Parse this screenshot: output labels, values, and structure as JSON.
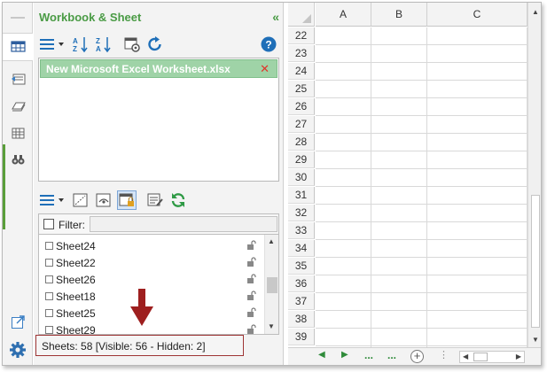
{
  "panel": {
    "title": "Workbook & Sheet",
    "collapse_glyph": "«"
  },
  "workbooks": [
    {
      "name": "New Microsoft Excel Worksheet.xlsx",
      "close_glyph": "✕"
    }
  ],
  "filter": {
    "label": "Filter:",
    "value": "",
    "placeholder": ""
  },
  "sheets": [
    {
      "name": "Sheet24"
    },
    {
      "name": "Sheet22"
    },
    {
      "name": "Sheet26"
    },
    {
      "name": "Sheet18"
    },
    {
      "name": "Sheet25"
    },
    {
      "name": "Sheet29"
    }
  ],
  "status": {
    "text": "Sheets: 58  [Visible: 56 - Hidden: 2]"
  },
  "grid": {
    "columns": [
      "A",
      "B",
      "C"
    ],
    "rows": [
      "22",
      "23",
      "24",
      "25",
      "26",
      "27",
      "28",
      "29",
      "30",
      "31",
      "32",
      "33",
      "34",
      "35",
      "36",
      "37",
      "38",
      "39"
    ]
  },
  "sheetbar": {
    "prev_glyph": "◀",
    "next_glyph": "▶",
    "ellipsis_left": "...",
    "ellipsis_right": "...",
    "add_glyph": "+"
  },
  "help_glyph": "?",
  "colors": {
    "accent_green": "#4a9b45",
    "selected_workbook_bg": "#9fd3a7",
    "close_red": "#e0352b",
    "status_border": "#9e3434",
    "blue_icons": "#1f6fb8"
  },
  "icons": {
    "strip": [
      "workbook-sheet-icon",
      "navigation-pane-icon",
      "autotext-icon",
      "column-list-icon",
      "find-replace-icon",
      "expand-icon",
      "settings-gear-icon"
    ],
    "toolbar_top": [
      "sort-menu-icon",
      "sort-ascending-icon",
      "sort-descending-icon",
      "workbook-options-icon",
      "refresh-icon",
      "help-icon"
    ],
    "toolbar_sheets": [
      "sheet-menu-icon",
      "hide-sheet-icon",
      "unhide-sheet-icon",
      "protect-sheet-icon",
      "sheet-options-icon",
      "refresh-sheets-icon"
    ]
  }
}
